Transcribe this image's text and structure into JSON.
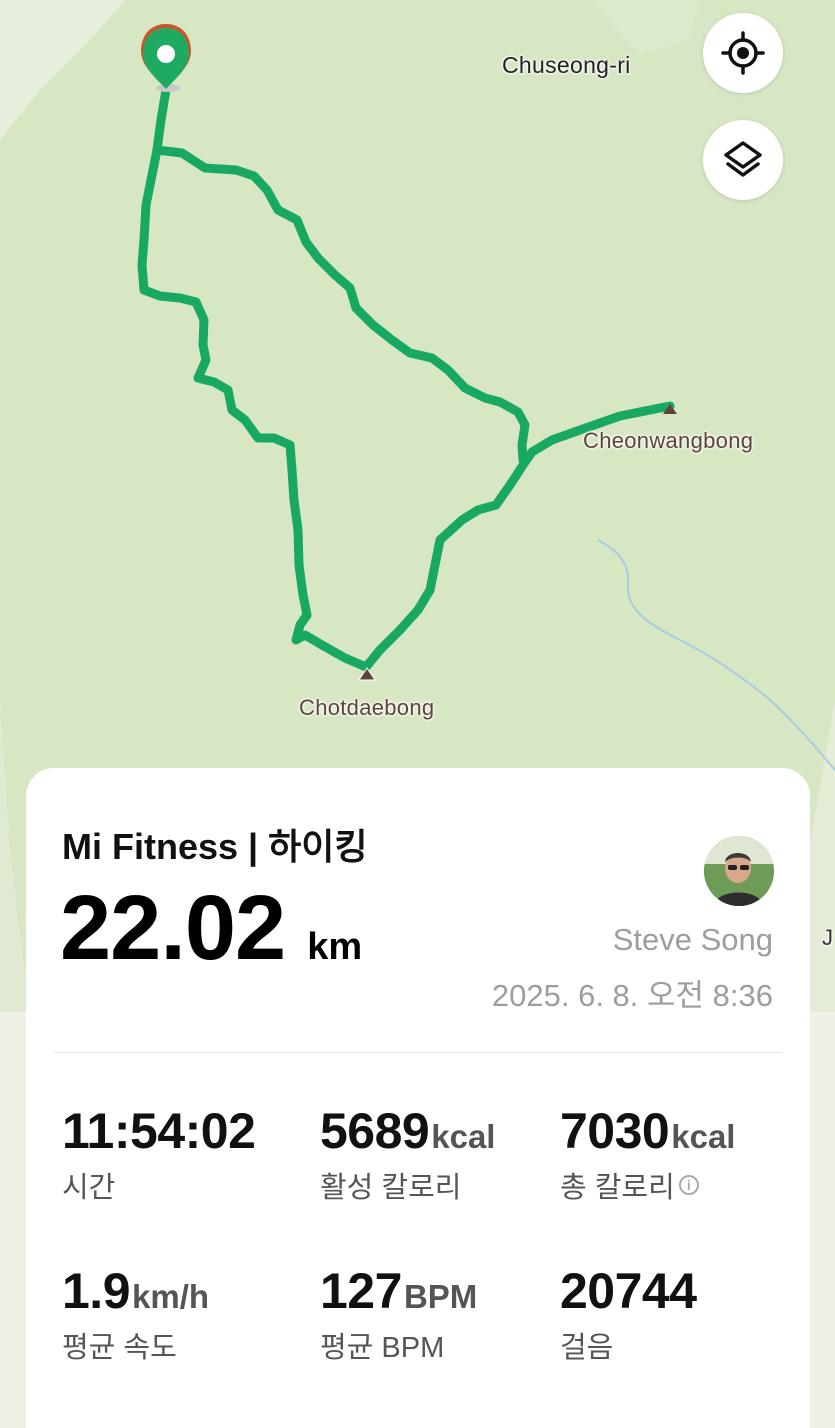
{
  "map": {
    "labels": {
      "village": "Chuseong-ri",
      "peak_east": "Cheonwangbong",
      "peak_south": "Chotdaebong",
      "edge_letter": "J"
    },
    "buttons": {
      "locate_icon": "crosshair-target-icon",
      "layers_icon": "layers-icon"
    },
    "route_color": "#19a862",
    "start_marker_color": "#1faa63"
  },
  "workout": {
    "title": "Mi Fitness | 하이킹",
    "distance": "22.02",
    "distance_unit": "km",
    "user_name": "Steve Song",
    "date": "2025. 6. 8. 오전 8:36",
    "stats": [
      {
        "value": "11:54:02",
        "unit": "",
        "label": "시간"
      },
      {
        "value": "5689",
        "unit": "kcal",
        "label": "활성 칼로리"
      },
      {
        "value": "7030",
        "unit": "kcal",
        "label": "총 칼로리"
      },
      {
        "value": "1.9",
        "unit": "km/h",
        "label": "평균 속도"
      },
      {
        "value": "127",
        "unit": "BPM",
        "label": "평균 BPM"
      },
      {
        "value": "20744",
        "unit": "",
        "label": "걸음"
      }
    ]
  }
}
